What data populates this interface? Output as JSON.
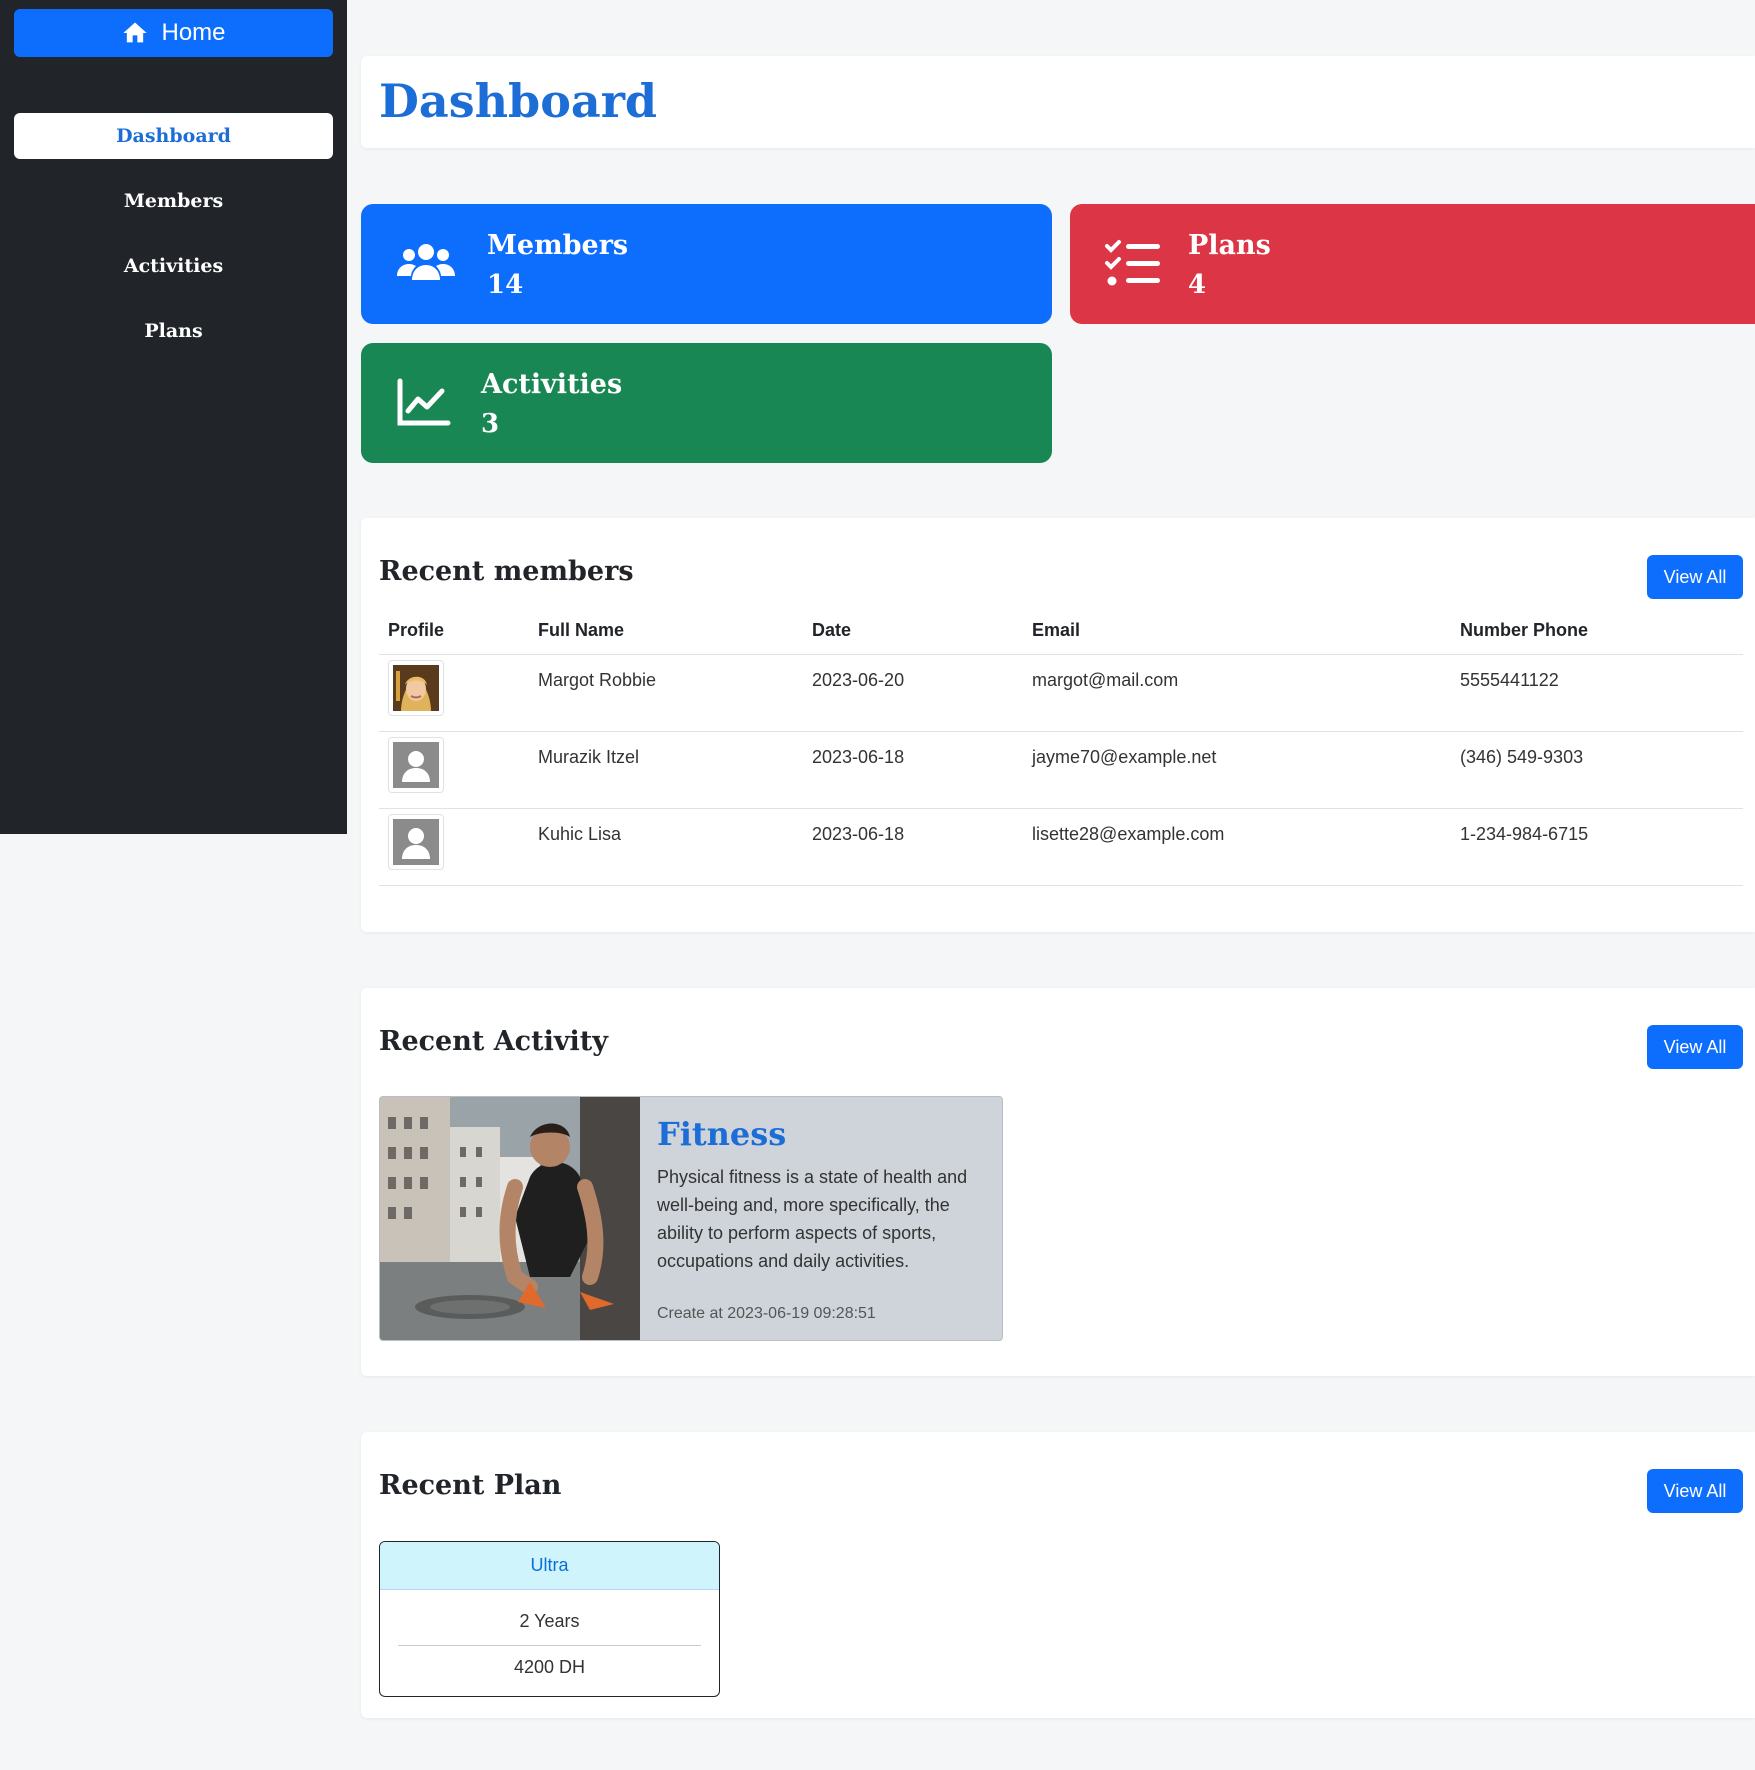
{
  "sidebar": {
    "home_label": "Home",
    "items": [
      {
        "label": "Dashboard",
        "active": true
      },
      {
        "label": "Members"
      },
      {
        "label": "Activities"
      },
      {
        "label": "Plans"
      }
    ]
  },
  "page": {
    "title": "Dashboard"
  },
  "stats": {
    "members": {
      "label": "Members",
      "count": "14",
      "color": "#0d6efd",
      "icon": "users-icon"
    },
    "plans": {
      "label": "Plans",
      "count": "4",
      "color": "#dc3545",
      "icon": "list-check-icon"
    },
    "activities": {
      "label": "Activities",
      "count": "3",
      "color": "#198754",
      "icon": "chart-line-icon"
    }
  },
  "recent_members": {
    "title": "Recent members",
    "view_all": "View All",
    "columns": [
      "Profile",
      "Full Name",
      "Date",
      "Email",
      "Number Phone"
    ],
    "rows": [
      {
        "avatar": "photo",
        "name": "Margot Robbie",
        "date": "2023-06-20",
        "email": "margot@mail.com",
        "phone": "5555441122"
      },
      {
        "avatar": "default-user-icon",
        "name": "Murazik Itzel",
        "date": "2023-06-18",
        "email": "jayme70@example.net",
        "phone": "(346) 549-9303"
      },
      {
        "avatar": "default-user-icon",
        "name": "Kuhic Lisa",
        "date": "2023-06-18",
        "email": "lisette28@example.com",
        "phone": "1-234-984-6715"
      }
    ]
  },
  "recent_activity": {
    "title": "Recent Activity",
    "view_all": "View All",
    "card": {
      "title": "Fitness",
      "description": "Physical fitness is a state of health and well-being and, more specifically, the ability to perform aspects of sports, occupations and daily activities.",
      "created": "Create at 2023-06-19 09:28:51"
    }
  },
  "recent_plan": {
    "title": "Recent Plan",
    "view_all": "View All",
    "card": {
      "name": "Ultra",
      "duration": "2 Years",
      "price": "4200 DH"
    }
  }
}
